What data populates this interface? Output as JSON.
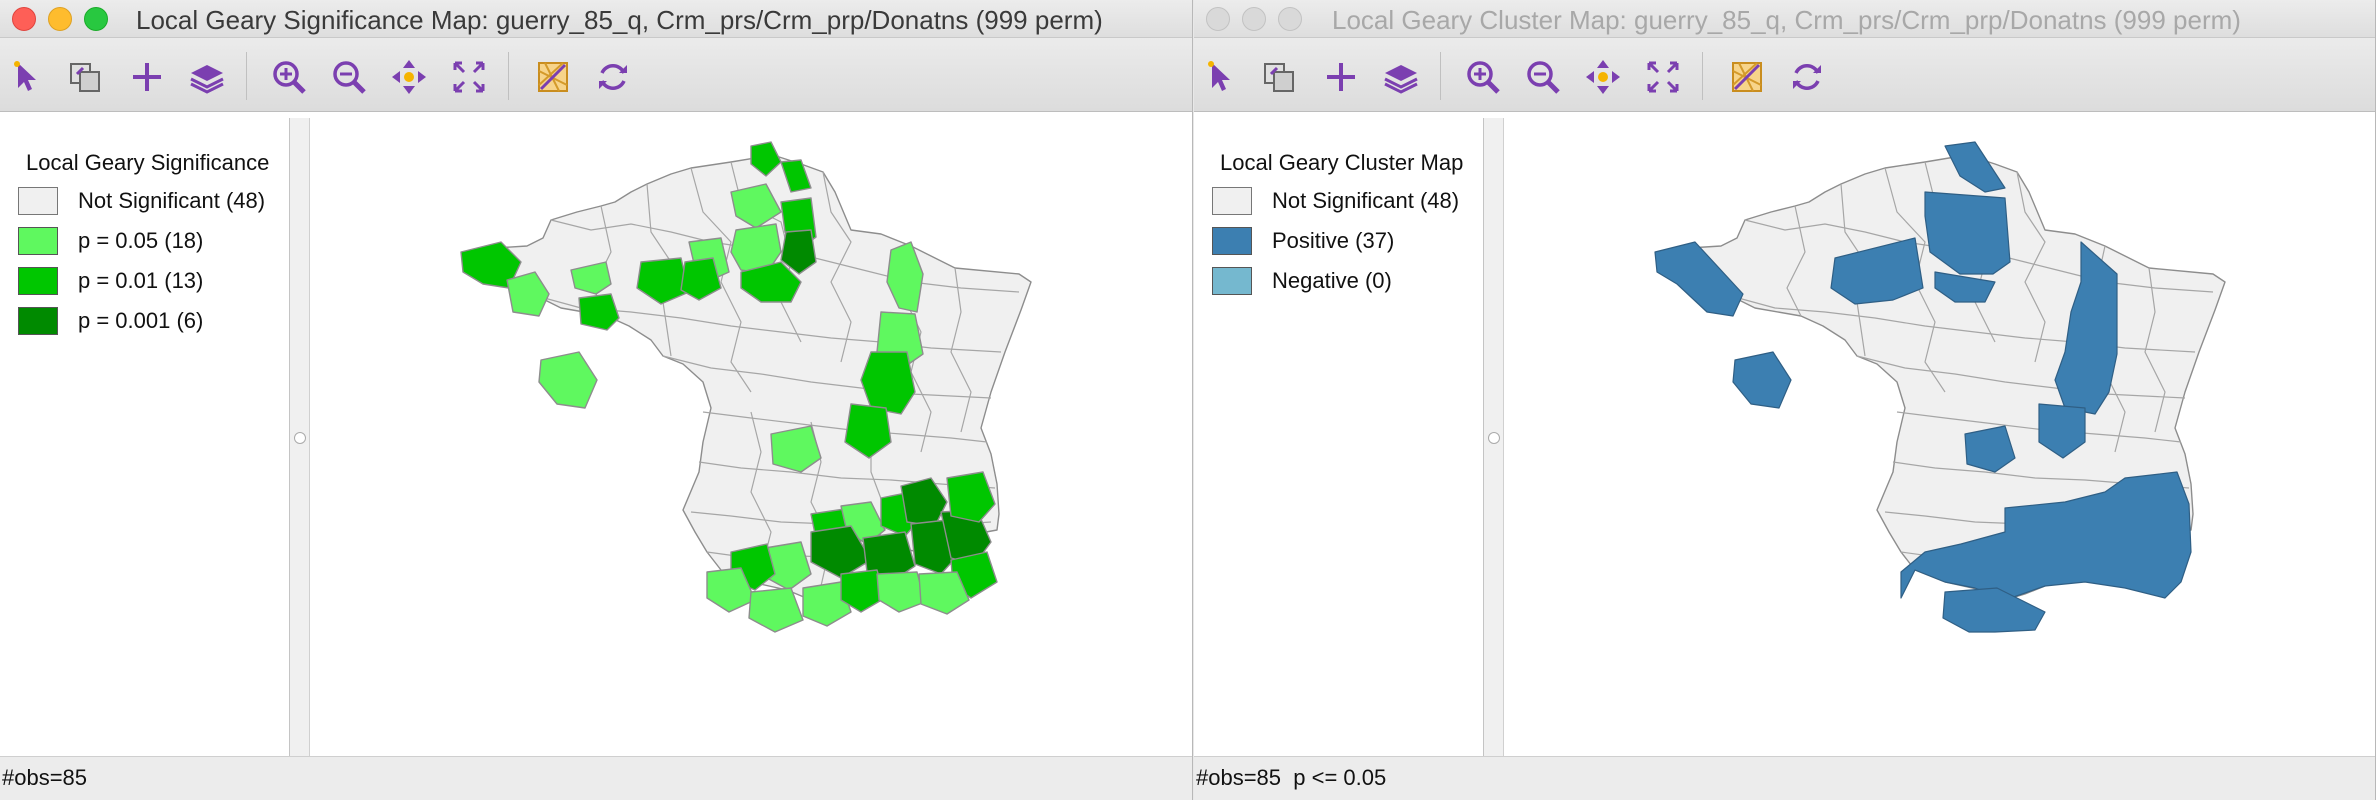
{
  "left_window": {
    "title": "Local Geary Significance Map: guerry_85_q, Crm_prs/Crm_prp/Donatns (999 perm)",
    "legend": {
      "title": "Local Geary Significance",
      "items": [
        {
          "label": "Not Significant (48)",
          "color": "#f0f0f0"
        },
        {
          "label": "p = 0.05 (18)",
          "color": "#5ff85f"
        },
        {
          "label": "p = 0.01 (13)",
          "color": "#00c600"
        },
        {
          "label": "p = 0.001 (6)",
          "color": "#008a00"
        }
      ]
    },
    "status": "#obs=85"
  },
  "right_window": {
    "title": "Local Geary Cluster Map: guerry_85_q, Crm_prs/Crm_prp/Donatns (999 perm)",
    "legend": {
      "title": "Local Geary Cluster Map",
      "items": [
        {
          "label": "Not Significant (48)",
          "color": "#f0f0f0"
        },
        {
          "label": "Positive (37)",
          "color": "#3c7fb1"
        },
        {
          "label": "Negative (0)",
          "color": "#75b8cf"
        }
      ]
    },
    "status": "#obs=85  p <= 0.05"
  },
  "toolbar_icons": [
    "select-icon",
    "copy-selection-icon",
    "add-icon",
    "layers-icon",
    "zoom-in-icon",
    "zoom-out-icon",
    "pan-icon",
    "fit-extent-icon",
    "toggle-basemap-icon",
    "refresh-icon"
  ],
  "colors": {
    "accent": "#7b3fb0",
    "map_border": "#8d8d8d"
  }
}
